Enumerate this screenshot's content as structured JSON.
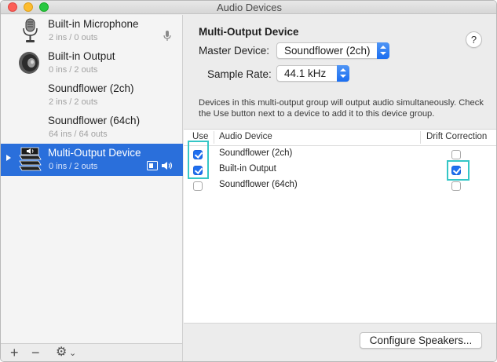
{
  "window": {
    "title": "Audio Devices"
  },
  "sidebar": {
    "devices": [
      {
        "name": "Built-in Microphone",
        "io": "2 ins / 0 outs",
        "icon": "microphone-icon",
        "badge": "mic-level-icon",
        "selected": false
      },
      {
        "name": "Built-in Output",
        "io": "0 ins / 2 outs",
        "icon": "speaker-icon",
        "selected": false
      },
      {
        "name": "Soundflower (2ch)",
        "io": "2 ins / 2 outs",
        "selected": false
      },
      {
        "name": "Soundflower (64ch)",
        "io": "64 ins / 64 outs",
        "selected": false
      },
      {
        "name": "Multi-Output Device",
        "io": "0 ins / 2 outs",
        "icon": "multi-output-icon",
        "selected": true
      }
    ],
    "toolbar": {
      "add": "+",
      "remove": "−",
      "gear": "⚙",
      "gear_caret": "⌄"
    }
  },
  "main": {
    "device_title": "Multi-Output Device",
    "help_label": "?",
    "master_device_label": "Master Device:",
    "master_device_value": "Soundflower (2ch)",
    "sample_rate_label": "Sample Rate:",
    "sample_rate_value": "44.1 kHz",
    "description": "Devices in this multi-output group will output audio simultaneously. Check the Use button next to a device to add it to this device group.",
    "table": {
      "headers": {
        "use": "Use",
        "device": "Audio Device",
        "drift": "Drift Correction"
      },
      "rows": [
        {
          "device": "Soundflower (2ch)",
          "use": true,
          "drift": false
        },
        {
          "device": "Built-in Output",
          "use": true,
          "drift": true
        },
        {
          "device": "Soundflower (64ch)",
          "use": false,
          "drift": false
        }
      ]
    },
    "configure_button": "Configure Speakers..."
  },
  "colors": {
    "selection": "#2a6fdb",
    "checkbox": "#1f6ff0",
    "highlight": "#35c6c6"
  }
}
